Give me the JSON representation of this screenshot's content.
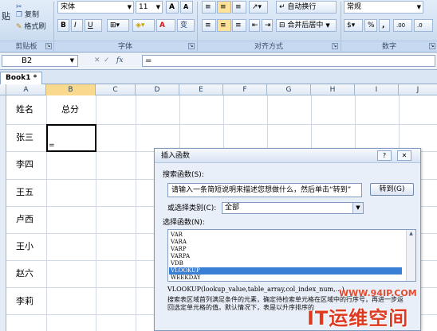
{
  "ribbon": {
    "clipboard": {
      "paste": "贴",
      "copy": "复制",
      "format_painter": "格式刷",
      "label": "剪贴板"
    },
    "font": {
      "name": "宋体",
      "size": "11",
      "grow": "A",
      "shrink": "A",
      "bold": "B",
      "italic": "I",
      "underline": "U",
      "color": "A",
      "phonetic": "变",
      "label": "字体"
    },
    "alignment": {
      "wrap_text": "自动换行",
      "merge_center": "合并后居中",
      "label": "对齐方式"
    },
    "number": {
      "format": "常规",
      "percent": "%",
      "comma": ",",
      "increase_decimal": ".00",
      "label": "数字"
    }
  },
  "formula_bar": {
    "name_box": "B2",
    "fx": "fx",
    "value": "="
  },
  "workbook": {
    "tab": "Book1 *"
  },
  "columns": [
    "A",
    "B",
    "C",
    "D",
    "E",
    "F",
    "G",
    "H",
    "I",
    "J"
  ],
  "cells": {
    "a1": "姓名",
    "b1": "总分",
    "a2": "张三",
    "b2": "=",
    "a3": "李四",
    "a4": "王五",
    "a5": "卢西",
    "a6": "王小",
    "a7": "赵六",
    "a8": "李莉"
  },
  "dialog": {
    "title": "插入函数",
    "help": "?",
    "close": "✕",
    "search_label": "搜索函数(S):",
    "search_value": "请输入一条简短说明来描述您想做什么，然后单击“转到”",
    "goto_button": "转到(G)",
    "category_label": "或选择类别(C):",
    "category_value": "全部",
    "function_label": "选择函数(N):",
    "functions": [
      "VAR",
      "VARA",
      "VARP",
      "VARPA",
      "VDB",
      "VLOOKUP",
      "WEEKDAY"
    ],
    "selected_function": "VLOOKUP",
    "syntax": "VLOOKUP(lookup_value,table_array,col_index_num,...)",
    "description": "搜索表区域首列满足条件的元素，确定待检索单元格在区域中的行序号，再进一步返回选定单元格的值。默认情况下，表是以升序排序的"
  },
  "watermark": {
    "url": "WWW.94IP.COM",
    "text": "IT运维空间"
  }
}
